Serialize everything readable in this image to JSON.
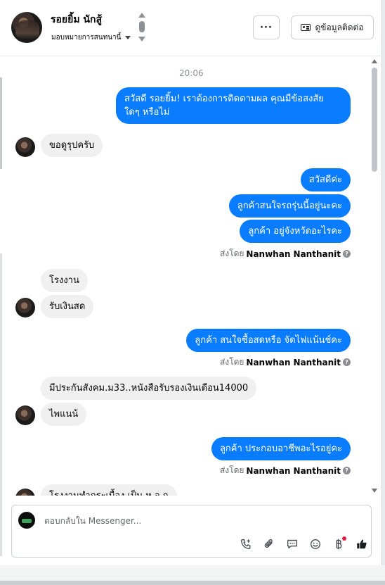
{
  "header": {
    "contact_name": "รอยยิ้ม นักสู้",
    "assign_label": "มอบหมายการสนทนานี้",
    "more_label": "···",
    "contact_info_label": "ดูข้อมูลติดต่อ"
  },
  "conversation": {
    "timestamp": "20:06",
    "messages": [
      {
        "direction": "out",
        "lines": [
          "สวัสดี รอยยิ้ม! เราต้องการติดตามผล คุณมีข้อสงสัย",
          "ใดๆ หรือไม่"
        ]
      },
      {
        "direction": "in",
        "text": "ขอดูรุปครับ"
      },
      {
        "direction": "out",
        "text": "สวัสดีค่ะ"
      },
      {
        "direction": "out",
        "text": "ลูกค้าสนใจรถรุ่นนี้อยู่นะคะ"
      },
      {
        "direction": "out",
        "text": "ลูกค้า อยู่จังหวัดอะไรคะ"
      },
      {
        "direction": "in",
        "text": "โรงงาน"
      },
      {
        "direction": "in",
        "text": "รับเงินสด"
      },
      {
        "direction": "out",
        "text": "ลูกค้า สนใจซื้อสดหรือ จัดไฟแน้นช์คะ"
      },
      {
        "direction": "in",
        "text": "มีประกันสังคม.ม33..หนังสือรับรองเงินเดือน14000"
      },
      {
        "direction": "in",
        "text": "ไพแนน้"
      },
      {
        "direction": "out",
        "text": "ลูกค้า ประกอบอาชีพอะไรอยู่คะ"
      },
      {
        "direction": "in",
        "text": "โรงงานทำกระเบื้อง เป็น ห.จ.ก"
      }
    ],
    "sent_by_prefix": "ส่งโดย",
    "sent_by_name": "Nanwhan Nanthanit"
  },
  "composer": {
    "placeholder": "ตอบกลับใน Messenger..."
  },
  "icons": {
    "call": "phone-plus-icon",
    "attach": "paperclip-icon",
    "saved_replies": "chat-bubble-icon",
    "emoji": "smiley-icon",
    "payment": "baht-icon",
    "like": "thumbs-up-icon"
  },
  "colors": {
    "outgoing_bubble": "#0a7cff",
    "incoming_bubble": "#f0f0f0",
    "notification_dot": "#e41e3f"
  }
}
